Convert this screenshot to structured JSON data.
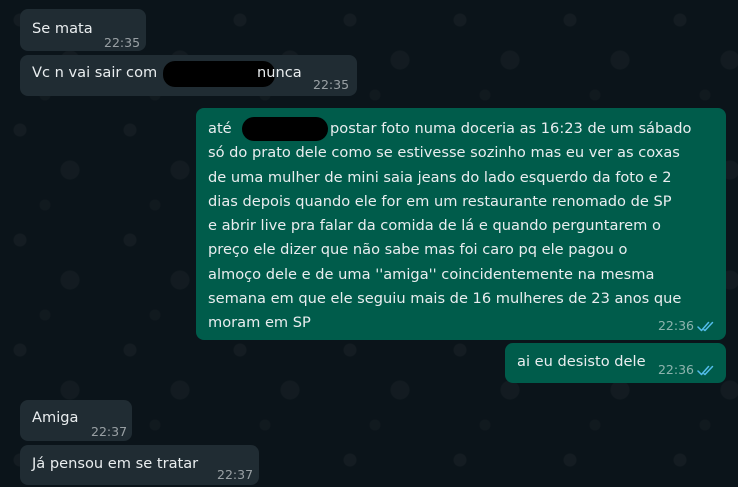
{
  "messages": [
    {
      "direction": "incoming",
      "text": "Se mata",
      "time": "22:35"
    },
    {
      "direction": "incoming",
      "text_before": "Vc n vai sair com",
      "text_after": "nunca",
      "time": "22:35"
    },
    {
      "direction": "outgoing",
      "lines": [
        {
          "pre": "até",
          "post": "postar foto numa doceria as 16:23 de um sábado"
        },
        "só do prato dele como se estivesse sozinho mas eu ver as coxas",
        "de uma mulher de mini saia jeans do lado esquerdo da foto e 2",
        "dias depois quando ele for em um restaurante renomado de SP",
        "e abrir live pra falar da comida de lá e quando perguntarem o",
        "preço ele dizer que não sabe mas foi caro pq ele pagou o",
        "almoço dele e de uma ''amiga'' coincidentemente na mesma",
        "semana em que ele seguiu mais de 16 mulheres de 23 anos que",
        "moram em SP"
      ],
      "time": "22:36",
      "status": "read"
    },
    {
      "direction": "outgoing",
      "text": "ai eu desisto dele",
      "time": "22:36",
      "status": "read"
    },
    {
      "direction": "incoming",
      "text": "Amiga",
      "time": "22:37"
    },
    {
      "direction": "incoming",
      "text": "Já pensou em se tratar",
      "time": "22:37"
    }
  ],
  "colors": {
    "background": "#0b141a",
    "incoming_bubble": "#202c33",
    "outgoing_bubble": "#005c4b",
    "read_ticks": "#53bdeb"
  }
}
